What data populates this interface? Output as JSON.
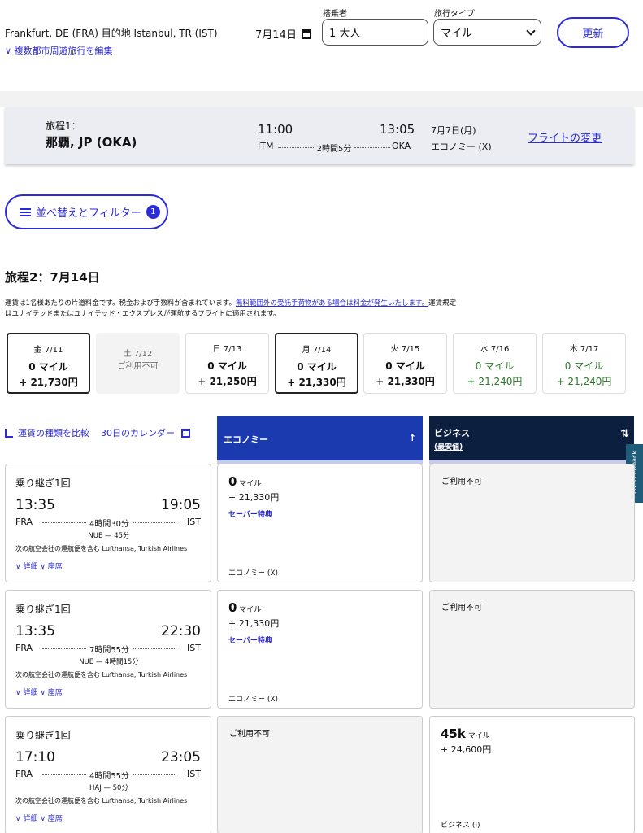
{
  "search": {
    "route": "Frankfurt, DE (FRA) 目的地 Istanbul, TR (IST)",
    "edit_multi": "複数都市周遊旅行を編集",
    "date": "7月14日",
    "passengers_label": "搭乗者",
    "passengers_value": "1 大人",
    "trip_type_label": "旅行タイプ",
    "trip_type_value": "マイル",
    "update_label": "更新"
  },
  "itinerary1": {
    "label": "旅程1：",
    "city": "那覇, JP (OKA)",
    "dep_time": "11:00",
    "arr_time": "13:05",
    "dep_code": "ITM",
    "arr_code": "OKA",
    "duration": "2時間5分",
    "date": "7月7日(月)",
    "cabin": "エコノミー (X)",
    "change_label": "フライトの変更"
  },
  "filter": {
    "label": "並べ替えとフィルター",
    "count": "1"
  },
  "itinerary2": {
    "title": "旅程2：7月14日",
    "note_text": "運賃は1名様あたりの片道料金です。税金および手数料が含まれています。",
    "note_link": "無料範囲外の受託手荷物がある場合は料金が発生いたします。",
    "note_text2": "運賃規定はユナイテッドまたはユナイテッド・エクスプレスが運航するフライトに適用されます。"
  },
  "dates": [
    {
      "day": "金 7/11",
      "miles": "0 マイル",
      "cash": "+ 21,730円",
      "selected": true,
      "green": false
    },
    {
      "day": "土 7/12",
      "unavail": "ご利用不可"
    },
    {
      "day": "日 7/13",
      "miles": "0 マイル",
      "cash": "+ 21,250円",
      "green": false
    },
    {
      "day": "月 7/14",
      "miles": "0 マイル",
      "cash": "+ 21,330円",
      "selected": true,
      "green": false
    },
    {
      "day": "火 7/15",
      "miles": "0 マイル",
      "cash": "+ 21,330円",
      "green": false
    },
    {
      "day": "水 7/16",
      "miles": "0 マイル",
      "cash": "+ 21,240円",
      "green": true
    },
    {
      "day": "木 7/17",
      "miles": "0 マイル",
      "cash": "+ 21,240円",
      "green": true
    }
  ],
  "compare": {
    "compare_label": "運賃の種類を比較",
    "calendar_label": "30日のカレンダー"
  },
  "columns": {
    "economy": "エコノミー",
    "business": "ビジネス",
    "business_sub": "(最安値)"
  },
  "feedback": "Site Feedback",
  "flights": [
    {
      "connections": "乗り継ぎ1回",
      "dep": "13:35",
      "arr": "19:05",
      "from": "FRA",
      "to": "IST",
      "duration": "4時間30分",
      "layover": "NUE — 45分",
      "operators": "次の航空会社の運航便を含む Lufthansa, Turkish Airlines",
      "details": "詳細",
      "seats": "座席",
      "economy": {
        "miles": "0",
        "unit": "マイル",
        "cash": "+ 21,330円",
        "saver": "セーバー特典",
        "cabin": "エコノミー (X)"
      },
      "business": {
        "na": "ご利用不可"
      }
    },
    {
      "connections": "乗り継ぎ1回",
      "dep": "13:35",
      "arr": "22:30",
      "from": "FRA",
      "to": "IST",
      "duration": "7時間55分",
      "layover": "NUE — 4時間15分",
      "operators": "次の航空会社の運航便を含む Lufthansa, Turkish Airlines",
      "details": "詳細",
      "seats": "座席",
      "economy": {
        "miles": "0",
        "unit": "マイル",
        "cash": "+ 21,330円",
        "saver": "セーバー特典",
        "cabin": "エコノミー (X)"
      },
      "business": {
        "na": "ご利用不可"
      }
    },
    {
      "connections": "乗り継ぎ1回",
      "dep": "17:10",
      "arr": "23:05",
      "from": "FRA",
      "to": "IST",
      "duration": "4時間55分",
      "layover": "HAJ — 50分",
      "operators": "次の航空会社の運航便を含む Lufthansa, Turkish Airlines",
      "details": "詳細",
      "seats": "座席",
      "economy": {
        "na": "ご利用不可"
      },
      "business": {
        "miles": "45k",
        "unit": "マイル",
        "cash": "+ 24,600円",
        "cabin": "ビジネス (I)"
      }
    }
  ]
}
